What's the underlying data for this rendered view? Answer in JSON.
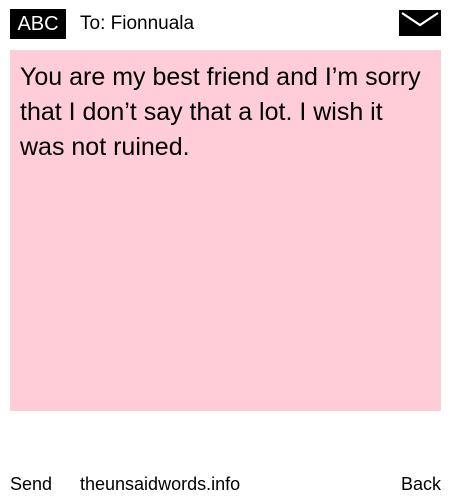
{
  "header": {
    "mode_badge": "ABC",
    "recipient": "To: Fionnuala",
    "envelope_icon": "envelope-icon"
  },
  "message": {
    "text": "You are my best friend and I’m sorry that I don’t say that a lot. I wish it was not ruined.",
    "background_color": "#ffcdd8"
  },
  "footer": {
    "send_label": "Send",
    "site_label": "theunsaidwords.info",
    "back_label": "Back"
  }
}
